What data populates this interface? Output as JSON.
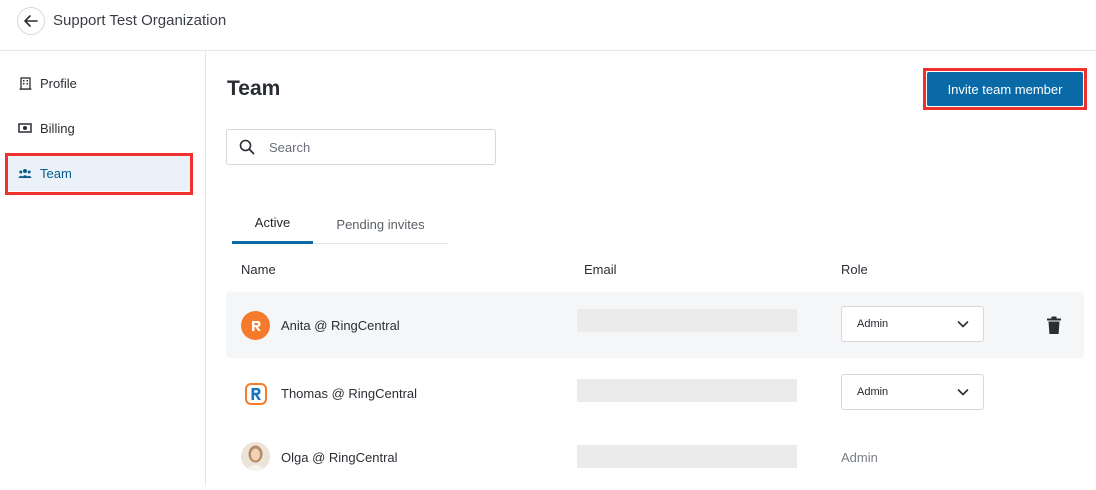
{
  "header": {
    "title": "Support Test Organization"
  },
  "sidebar": {
    "items": [
      {
        "label": "Profile",
        "icon": "building-icon"
      },
      {
        "label": "Billing",
        "icon": "money-icon"
      },
      {
        "label": "Team",
        "icon": "people-icon",
        "active": true
      }
    ]
  },
  "main": {
    "title": "Team",
    "invite_label": "Invite team member",
    "search": {
      "placeholder": "Search",
      "value": ""
    },
    "tabs": [
      {
        "label": "Active",
        "active": true
      },
      {
        "label": "Pending invites"
      }
    ],
    "columns": {
      "name": "Name",
      "email": "Email",
      "role": "Role"
    },
    "members": [
      {
        "name": "Anita @ RingCentral",
        "role": "Admin",
        "editable": true,
        "avatar": "ringcentral-orange-logo"
      },
      {
        "name": "Thomas @ RingCentral",
        "role": "Admin",
        "editable": true,
        "avatar": "ringcentral-blue-logo"
      },
      {
        "name": "Olga @ RingCentral",
        "role": "Admin",
        "editable": false,
        "avatar": "photo-avatar"
      }
    ]
  },
  "colors": {
    "accent": "#0a6aa8",
    "highlight": "#f0302c",
    "active_bg": "#eaf1f8",
    "ringcentral_orange": "#f57b2a"
  }
}
